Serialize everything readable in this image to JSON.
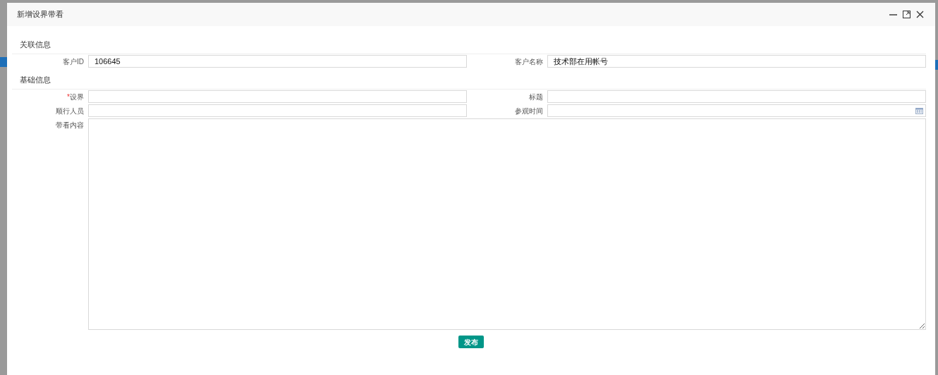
{
  "dialog": {
    "title": "新增设界带看"
  },
  "sections": [
    {
      "title": "关联信息",
      "fields": [
        {
          "label": "客户ID",
          "value": "106645",
          "kind": "text"
        },
        {
          "label": "客户名称",
          "value": "技术部在用帐号",
          "kind": "text"
        }
      ]
    },
    {
      "title": "基础信息",
      "fields": [
        {
          "label": "设界",
          "required_mark": "*",
          "kind": "text"
        },
        {
          "label": "标题",
          "kind": "text"
        },
        {
          "label": "顺行人员",
          "kind": "text"
        },
        {
          "label": "参观时间",
          "kind": "date"
        },
        {
          "label": "带看内容",
          "kind": "textarea"
        }
      ]
    }
  ],
  "submit_button": "发布"
}
